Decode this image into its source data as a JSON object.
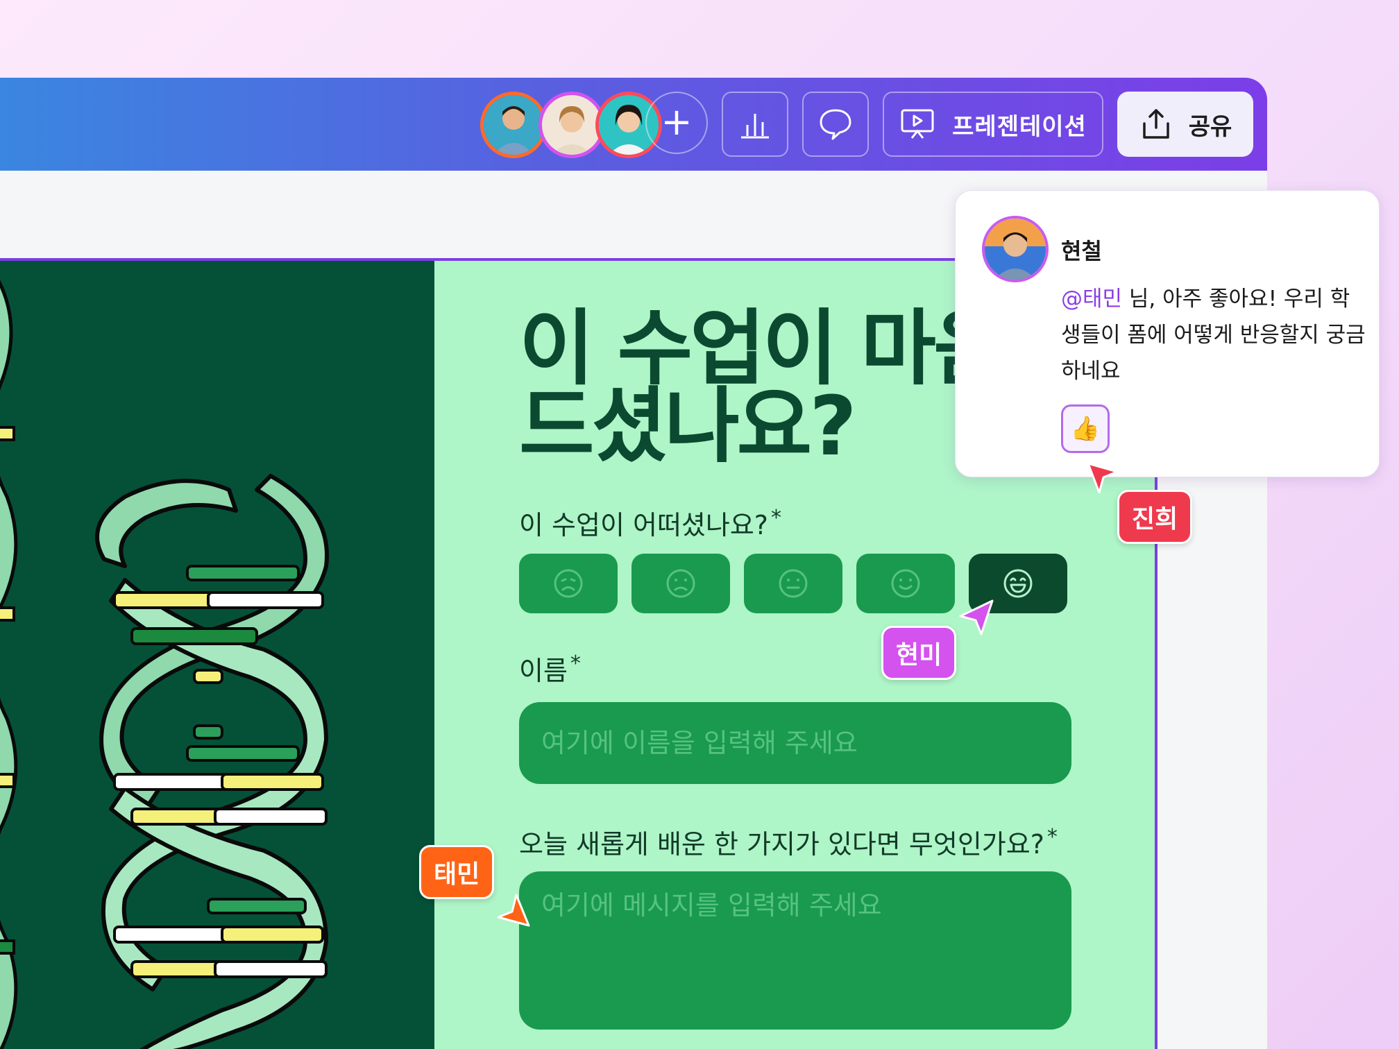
{
  "toolbar": {
    "collaborators": [
      {
        "name": "avatar-1"
      },
      {
        "name": "avatar-2"
      },
      {
        "name": "avatar-3"
      }
    ],
    "add_label": "+",
    "presentation_label": "프레젠테이션",
    "share_label": "공유"
  },
  "slide": {
    "title": "이 수업이 마음에\n드셨나요?",
    "q1": "이 수업이 어떠셨나요?",
    "required_mark": "*",
    "ratings": [
      "very-sad",
      "sad",
      "neutral",
      "happy",
      "very-happy"
    ],
    "selected_rating": 4,
    "q2": "이름",
    "name_placeholder": "여기에 이름을 입력해 주세요",
    "q3": "오늘 새롭게 배운 한 가지가 있다면 무엇인가요?",
    "message_placeholder": "여기에 메시지를 입력해 주세요"
  },
  "comment": {
    "author": "현철",
    "mention": "@태민",
    "text": " 님, 아주 좋아요! 우리 학생들이 폼에 어떻게 반응할지 궁금하네요",
    "reaction": "👍"
  },
  "cursors": {
    "jinhee": "진희",
    "hyunmi": "현미",
    "taemin": "태민"
  },
  "colors": {
    "toolbar_start": "#3a86e0",
    "toolbar_end": "#7c3ee8",
    "slide_bg": "#aef5c8",
    "dna_bg": "#055137",
    "field_bg": "#1a9a4e",
    "selected_rating": "#0c4a2e",
    "cursor_jinhee": "#ef3a4e",
    "cursor_hyunmi": "#d452ee",
    "cursor_taemin": "#ff6416"
  }
}
